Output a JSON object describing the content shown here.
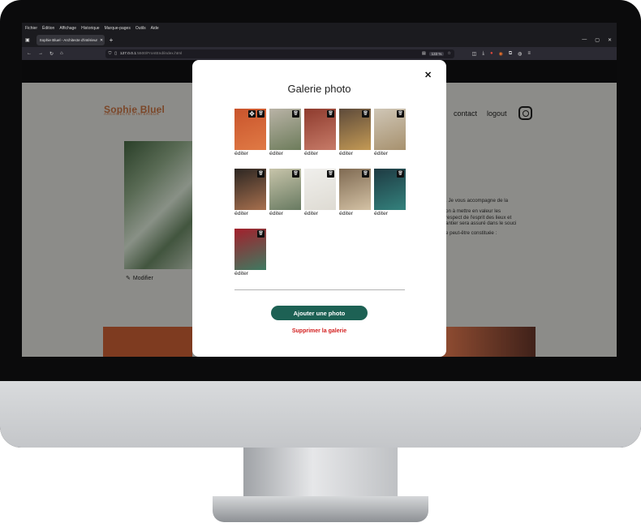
{
  "browser": {
    "menu": [
      "Fichier",
      "Édition",
      "Affichage",
      "Historique",
      "Marque-pages",
      "Outils",
      "Aide"
    ],
    "tab_title": "Sophie Bluel - Architecte d'intérieur",
    "url_main": "127.0.0.1",
    "url_rest": ":5500/FrontEnd/index.html",
    "zoom": "133 %"
  },
  "site": {
    "logo": "Sophie Bluel",
    "logo_sub": "ARCHITECTE D'INTÉRIEUR",
    "nav": [
      "contact",
      "logout"
    ],
    "modifier_label": "Modifier",
    "desc_lines": [
      ". Je vous accompagne de la",
      "on à mettre en valeur les",
      "respect de l'esprit des lieux et",
      "antier sera assuré dans le souci",
      "e peut-être constituée :"
    ]
  },
  "modal": {
    "title": "Galerie photo",
    "close_symbol": "✕",
    "edit_label": "éditer",
    "add_button": "Ajouter une photo",
    "delete_link": "Supprimer la galerie",
    "photos": [
      {
        "colors": [
          "#c9542c",
          "#e07a45"
        ],
        "has_move": true
      },
      {
        "colors": [
          "#b9b3a6",
          "#6d7c5b"
        ]
      },
      {
        "colors": [
          "#8e3b2e",
          "#c77b68"
        ]
      },
      {
        "colors": [
          "#5d4a3a",
          "#c49a55"
        ]
      },
      {
        "colors": [
          "#cfc6b6",
          "#a7916e"
        ]
      },
      {
        "colors": [
          "#2c2622",
          "#a8704e"
        ]
      },
      {
        "colors": [
          "#c7c4aa",
          "#687a61"
        ]
      },
      {
        "colors": [
          "#f0efec",
          "#dedbd3"
        ]
      },
      {
        "colors": [
          "#7f6a52",
          "#d4c2a5"
        ]
      },
      {
        "colors": [
          "#1e3a42",
          "#34827d"
        ]
      },
      {
        "colors": [
          "#a3202c",
          "#3e7a61"
        ]
      }
    ]
  }
}
